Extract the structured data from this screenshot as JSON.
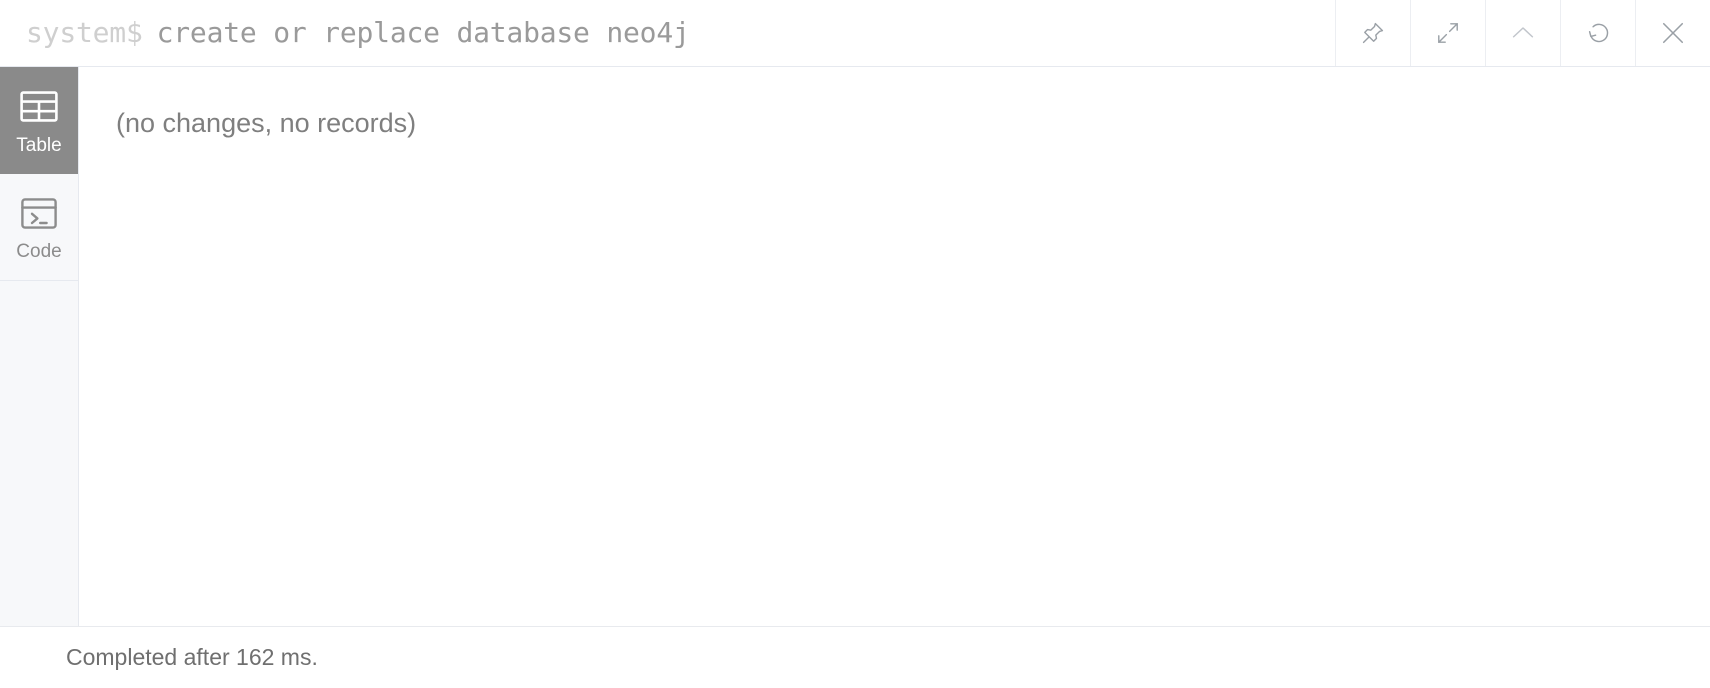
{
  "frame": {
    "query": {
      "prefix": "system$",
      "text": "create or replace database neo4j"
    },
    "actions": [
      {
        "name": "pin-icon",
        "label": "Pin"
      },
      {
        "name": "expand-icon",
        "label": "Fullscreen"
      },
      {
        "name": "chevron-up-icon",
        "label": "Collapse"
      },
      {
        "name": "rerun-icon",
        "label": "Rerun"
      },
      {
        "name": "close-icon",
        "label": "Close"
      }
    ],
    "views": [
      {
        "label": "Table",
        "icon": "table-icon",
        "active": true
      },
      {
        "label": "Code",
        "icon": "code-icon",
        "active": false
      }
    ],
    "result": {
      "message": "(no changes, no records)"
    },
    "footer": {
      "status": "Completed after 162 ms."
    }
  },
  "colors": {
    "active_view_bg": "#8a8a8a",
    "sidebar_bg": "#f7f8fa",
    "border": "#e6e9ef",
    "query_prefix": "#cfcfcf",
    "query_text": "#9a9a9a",
    "result_text": "#7f7f7f",
    "footer_text": "#6f6f6f",
    "icon_stroke": "#9aa0a6"
  }
}
